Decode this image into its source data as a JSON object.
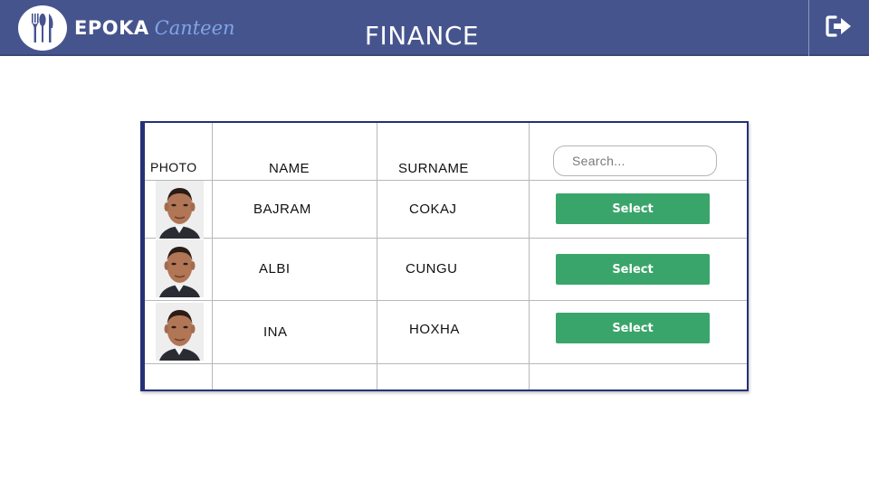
{
  "header": {
    "brand_name": "EPOKA",
    "brand_sub": "Canteen",
    "title": "FINANCE",
    "logout_icon": "sign-out-icon"
  },
  "table": {
    "columns": [
      "PHOTO",
      "NAME",
      "SURNAME"
    ],
    "search_placeholder": "Search...",
    "rows": [
      {
        "name": "BAJRAM",
        "surname": "COKAJ",
        "action": "Select"
      },
      {
        "name": "ALBI",
        "surname": "CUNGU",
        "action": "Select"
      },
      {
        "name": "INA",
        "surname": "HOXHA",
        "action": "Select"
      }
    ]
  },
  "colors": {
    "topbar": "#46548e",
    "select_button": "#3aa56a",
    "table_border": "#243178",
    "brand_accent": "#7fa6e6"
  }
}
